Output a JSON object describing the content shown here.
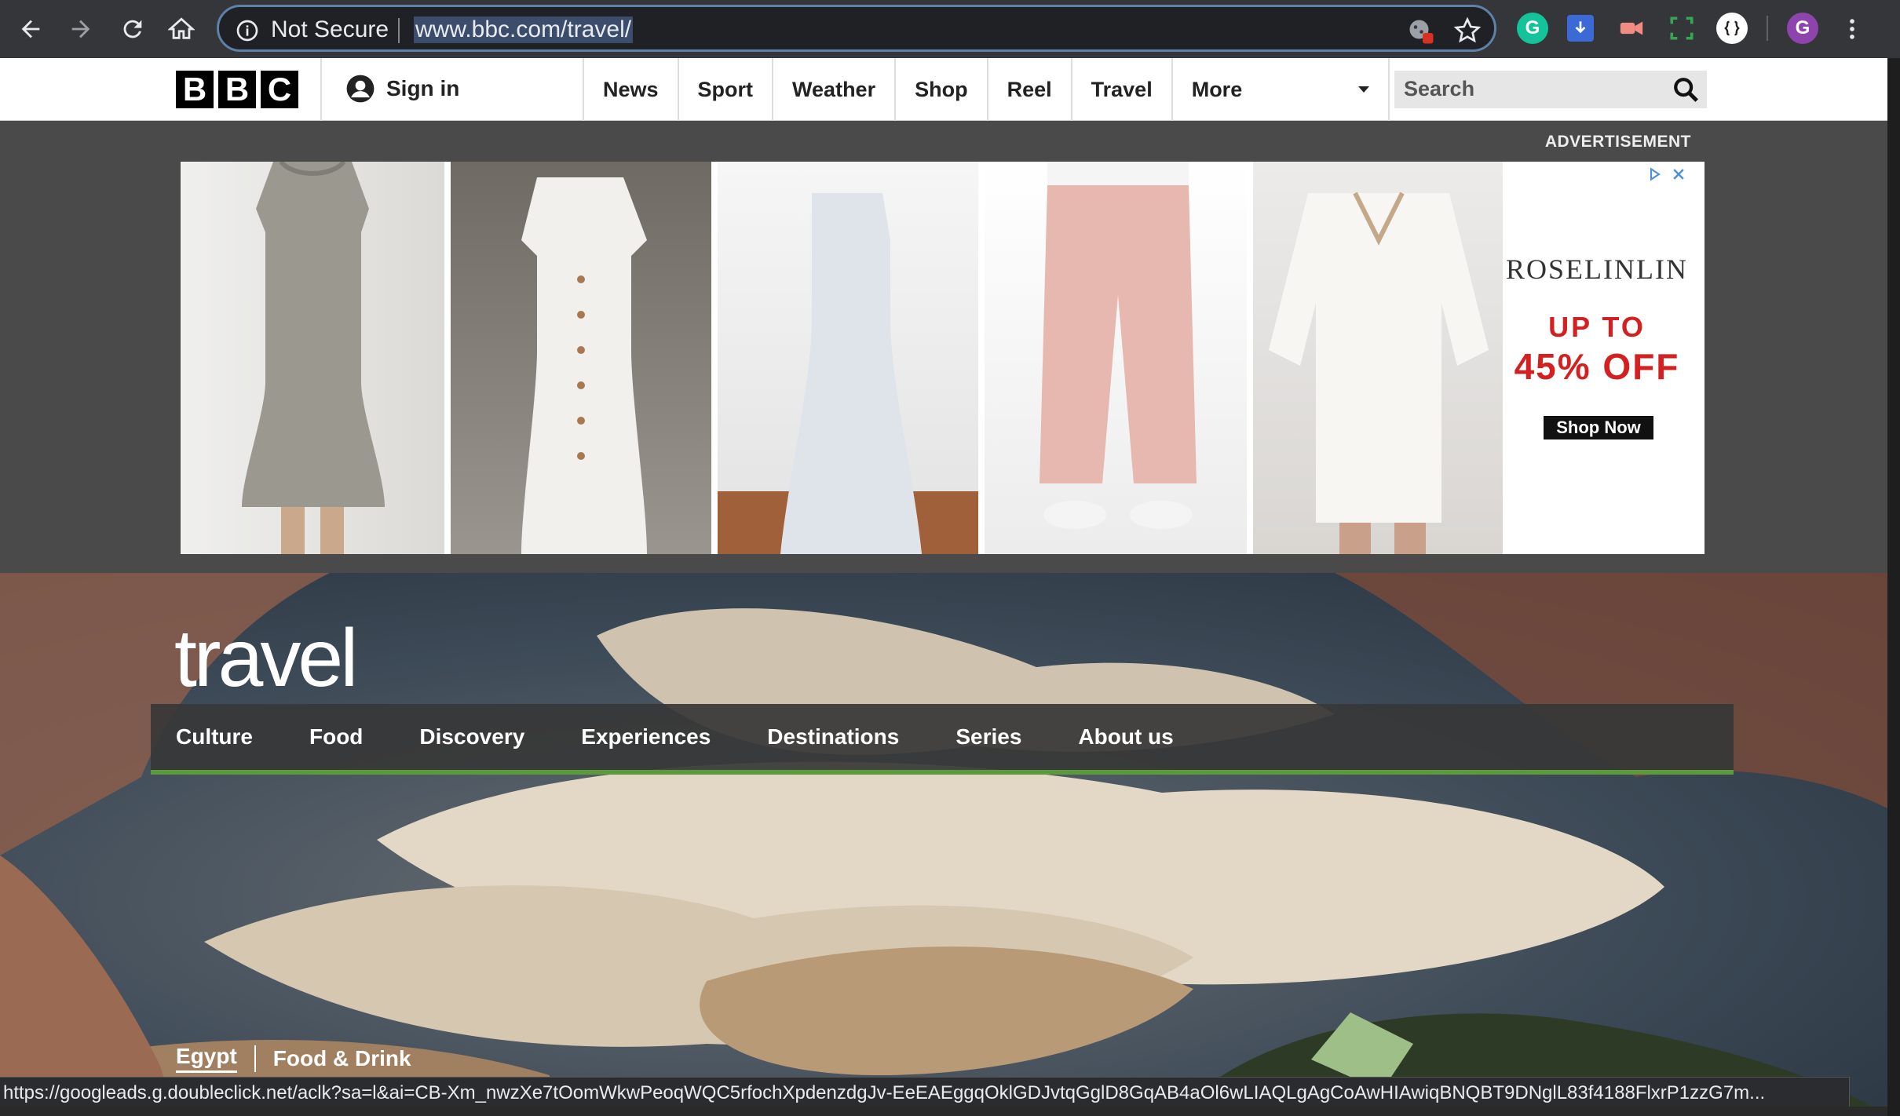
{
  "browser": {
    "security_label": "Not Secure",
    "url": "www.bbc.com/travel/",
    "status_url": "https://googleads.g.doubleclick.net/aclk?sa=l&ai=CB-Xm_nwzXe7tOomWkwPeoqWQC5rfochXpdenzdgJv-EeEAEggqOklGDJvtqGglD8GqAB4aOl6wLIAQLgAgCoAwHIAwiqBNQBT9DNglL83f4188FlxrP1zzG7m...",
    "profile_initial": "G",
    "extension_initial": "G"
  },
  "bbc_header": {
    "logo_letters": [
      "B",
      "B",
      "C"
    ],
    "sign_in": "Sign in",
    "nav": [
      "News",
      "Sport",
      "Weather",
      "Shop",
      "Reel",
      "Travel"
    ],
    "more": "More",
    "search_placeholder": "Search"
  },
  "ad": {
    "label": "ADVERTISEMENT",
    "brand": "ROSELINLIN",
    "headline": "UP TO",
    "offer": "45% OFF",
    "cta": "Shop Now"
  },
  "travel": {
    "logo": "travel",
    "nav": [
      "Culture",
      "Food",
      "Discovery",
      "Experiences",
      "Destinations",
      "Series",
      "About us"
    ],
    "breadcrumbs": [
      "Egypt",
      "Food & Drink"
    ]
  },
  "colors": {
    "accent_green": "#5a9a3a",
    "chrome_bg": "#35363a",
    "ad_red": "#d42020"
  }
}
